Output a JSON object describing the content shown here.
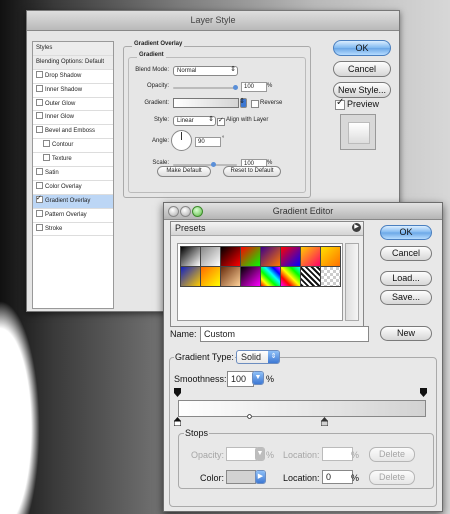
{
  "layer_style": {
    "title": "Layer Style",
    "styles_list": [
      {
        "label": "Styles",
        "type": "head",
        "checked": false,
        "selected": false
      },
      {
        "label": "Blending Options: Default",
        "type": "head",
        "checked": false,
        "selected": false
      },
      {
        "label": "Drop Shadow",
        "type": "item",
        "checked": false,
        "selected": false
      },
      {
        "label": "Inner Shadow",
        "type": "item",
        "checked": false,
        "selected": false
      },
      {
        "label": "Outer Glow",
        "type": "item",
        "checked": false,
        "selected": false
      },
      {
        "label": "Inner Glow",
        "type": "item",
        "checked": false,
        "selected": false
      },
      {
        "label": "Bevel and Emboss",
        "type": "item",
        "checked": false,
        "selected": false
      },
      {
        "label": "Contour",
        "type": "sub",
        "checked": false,
        "selected": false
      },
      {
        "label": "Texture",
        "type": "sub",
        "checked": false,
        "selected": false
      },
      {
        "label": "Satin",
        "type": "item",
        "checked": false,
        "selected": false
      },
      {
        "label": "Color Overlay",
        "type": "item",
        "checked": false,
        "selected": false
      },
      {
        "label": "Gradient Overlay",
        "type": "item",
        "checked": true,
        "selected": true
      },
      {
        "label": "Pattern Overlay",
        "type": "item",
        "checked": false,
        "selected": false
      },
      {
        "label": "Stroke",
        "type": "item",
        "checked": false,
        "selected": false
      }
    ],
    "panel": {
      "title": "Gradient Overlay",
      "group": "Gradient",
      "blend_mode_label": "Blend Mode:",
      "blend_mode_value": "Normal",
      "opacity_label": "Opacity:",
      "opacity_value": "100",
      "opacity_unit": "%",
      "gradient_label": "Gradient:",
      "reverse_label": "Reverse",
      "reverse_checked": false,
      "style_label": "Style:",
      "style_value": "Linear",
      "align_label": "Align with Layer",
      "align_checked": true,
      "angle_label": "Angle:",
      "angle_value": "90",
      "angle_unit": "°",
      "scale_label": "Scale:",
      "scale_value": "100",
      "scale_unit": "%",
      "make_default": "Make Default",
      "reset_default": "Reset to Default"
    },
    "buttons": {
      "ok": "OK",
      "cancel": "Cancel",
      "new_style": "New Style..."
    },
    "preview_label": "Preview",
    "preview_checked": true
  },
  "gradient_editor": {
    "title": "Gradient Editor",
    "presets_label": "Presets",
    "presets_menu_icon": "triangle-right-icon",
    "swatches": [
      [
        "#000",
        "#fff"
      ],
      [
        "#888",
        "#fff"
      ],
      [
        "#000",
        "#ff0000"
      ],
      [
        "#ff0000",
        "#00ff00"
      ],
      [
        "#3c0088",
        "#ff7a00"
      ],
      [
        "#ff0000",
        "#0000ff"
      ],
      [
        "#ffcc00",
        "#ff0066"
      ],
      [
        "#ffe000",
        "#ff7000"
      ],
      [
        "#1020c0",
        "#ffcc00"
      ],
      [
        "#ff6a00",
        "#ffff00"
      ],
      [
        "#6a2d0d",
        "#ffd29a"
      ],
      [
        "#000",
        "#ff00ff"
      ],
      [
        "#ff0000",
        "#0000ff"
      ],
      [
        "#ff00ff",
        "#00ffff"
      ],
      [
        "stripes",
        "stripes"
      ],
      [
        "checker",
        "checker"
      ]
    ],
    "buttons": {
      "ok": "OK",
      "cancel": "Cancel",
      "load": "Load...",
      "save": "Save...",
      "new": "New"
    },
    "name_label": "Name:",
    "name_value": "Custom",
    "type_label": "Gradient Type:",
    "type_value": "Solid",
    "smoothness_label": "Smoothness:",
    "smoothness_value": "100",
    "smoothness_unit": "%",
    "stops_label": "Stops",
    "opacity_label": "Opacity:",
    "opacity_unit": "%",
    "location_label": "Location:",
    "location_unit": "%",
    "location_value": "0",
    "delete_label": "Delete",
    "color_label": "Color:",
    "gradient_start": "#ffffff",
    "gradient_end": "#d2d2d2"
  }
}
